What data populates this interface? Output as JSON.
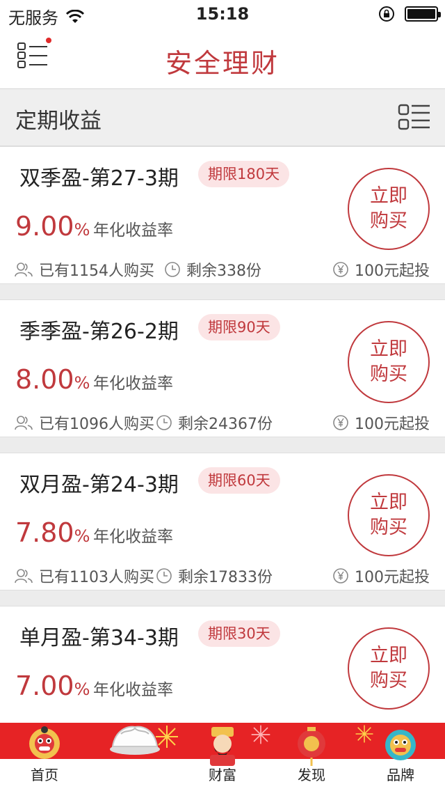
{
  "status_bar": {
    "carrier": "无服务",
    "time": "15:18"
  },
  "nav": {
    "title": "安全理财"
  },
  "section": {
    "title": "定期收益"
  },
  "products": [
    {
      "name": "双季盈-第27-3期",
      "term": "期限180天",
      "rate": "9.00",
      "rate_unit": "%",
      "rate_label": "年化收益率",
      "buyers": "已有1154人购买",
      "remaining": "剩余338份",
      "min_invest": "100元起投",
      "buy_label_1": "立即",
      "buy_label_2": "购买"
    },
    {
      "name": "季季盈-第26-2期",
      "term": "期限90天",
      "rate": "8.00",
      "rate_unit": "%",
      "rate_label": "年化收益率",
      "buyers": "已有1096人购买",
      "remaining": "剩余24367份",
      "min_invest": "100元起投",
      "buy_label_1": "立即",
      "buy_label_2": "购买"
    },
    {
      "name": "双月盈-第24-3期",
      "term": "期限60天",
      "rate": "7.80",
      "rate_unit": "%",
      "rate_label": "年化收益率",
      "buyers": "已有1103人购买",
      "remaining": "剩余17833份",
      "min_invest": "100元起投",
      "buy_label_1": "立即",
      "buy_label_2": "购买"
    },
    {
      "name": "单月盈-第34-3期",
      "term": "期限30天",
      "rate": "7.00",
      "rate_unit": "%",
      "rate_label": "年化收益率",
      "buy_label_1": "立即",
      "buy_label_2": "购买"
    }
  ],
  "tabs": [
    {
      "label": "首页",
      "icon": "lion-dance-icon"
    },
    {
      "label": "",
      "icon": "dumpling-icon"
    },
    {
      "label": "财富",
      "icon": "god-of-wealth-icon"
    },
    {
      "label": "发现",
      "icon": "lantern-icon"
    },
    {
      "label": "品牌",
      "icon": "lion-head-icon"
    }
  ],
  "colors": {
    "accent": "#c0393d",
    "tab_red": "#e62325",
    "term_badge_bg": "#fbe4e5"
  }
}
